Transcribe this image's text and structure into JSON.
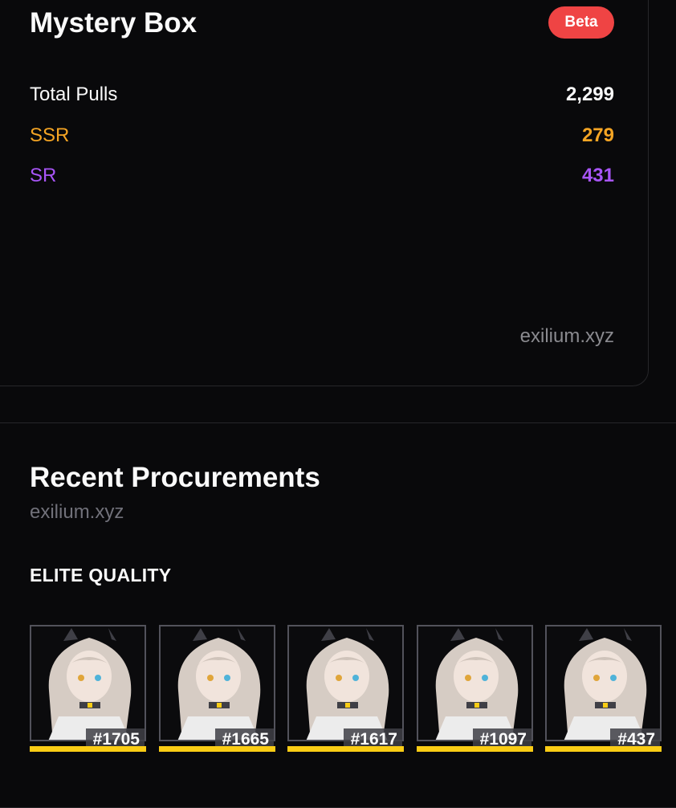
{
  "mystery_box": {
    "title": "Mystery Box",
    "badge": "Beta",
    "stats": [
      {
        "label": "Total Pulls",
        "value": "2,299"
      },
      {
        "label": "SSR",
        "value": "279"
      },
      {
        "label": "SR",
        "value": "431"
      }
    ],
    "watermark": "exilium.xyz"
  },
  "recent": {
    "title": "Recent Procurements",
    "watermark": "exilium.xyz",
    "section_label": "ELITE QUALITY",
    "items": [
      {
        "id": "#1705"
      },
      {
        "id": "#1665"
      },
      {
        "id": "#1617"
      },
      {
        "id": "#1097"
      },
      {
        "id": "#437"
      }
    ]
  },
  "colors": {
    "badge": "#ef4444",
    "ssr": "#f5a524",
    "sr": "#a855f7",
    "rarity_bar": "#facc15"
  }
}
